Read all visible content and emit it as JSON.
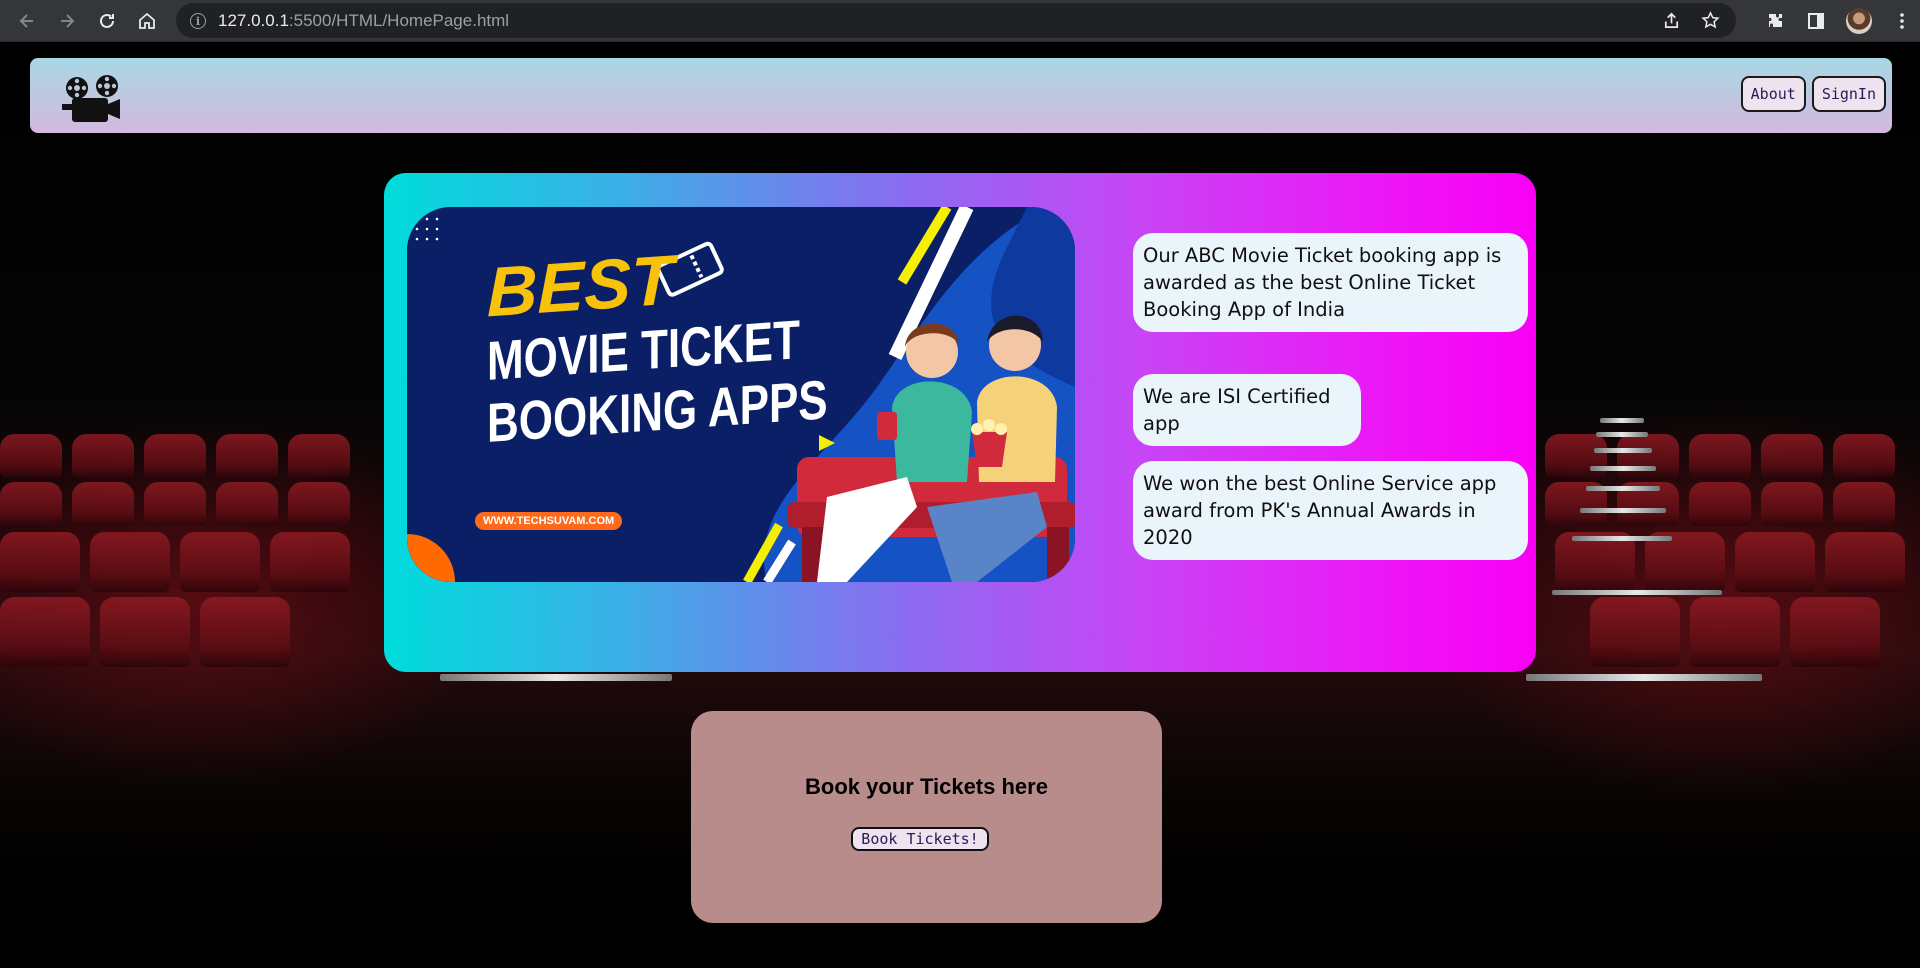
{
  "browser": {
    "url_host": "127.0.0.1",
    "url_rest": ":5500/HTML/HomePage.html"
  },
  "navbar": {
    "logo_icon": "film-projector-icon",
    "about_label": "About",
    "signin_label": "SignIn"
  },
  "hero": {
    "banner": {
      "line1": "BEST",
      "line2": "MOVIE TICKET",
      "line3": "BOOKING APPS",
      "website": "WWW.TECHSUVAM.COM"
    },
    "facts": [
      "Our ABC Movie Ticket booking app is awarded as the best Online Ticket Booking App of India",
      "We are ISI Certified app",
      "We won the best Online Service app award from PK's Annual Awards in 2020"
    ]
  },
  "booking": {
    "title": "Book your Tickets here",
    "button_label": "Book Tickets!"
  },
  "colors": {
    "navbar_top": "#a8d8e4",
    "navbar_bottom": "#d4b8dd",
    "hero_left": "#00dcdc",
    "hero_right": "#f800f5",
    "bookbox": "#b98c8c"
  }
}
